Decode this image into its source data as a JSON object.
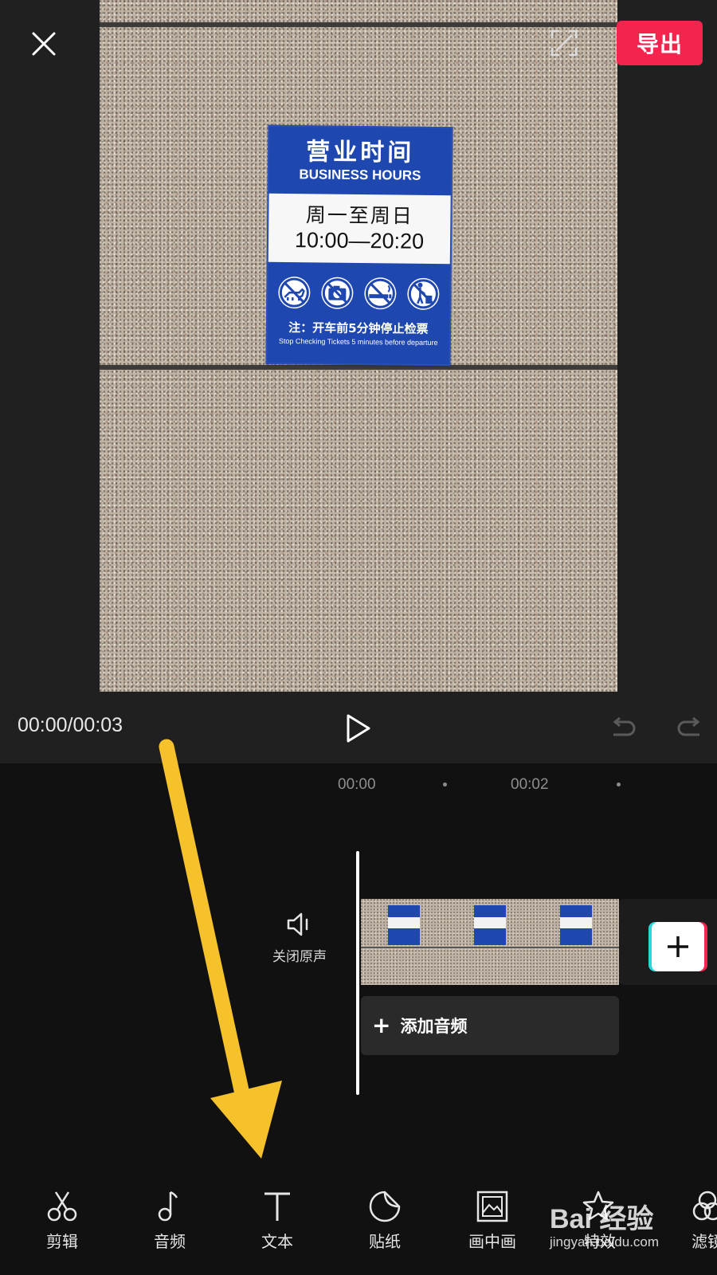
{
  "header": {
    "export_label": "导出"
  },
  "preview": {
    "sign": {
      "title_cn": "营业时间",
      "title_en": "BUSINESS HOURS",
      "days": "周一至周日",
      "hours": "10:00—20:20",
      "note_cn": "注：开车前5分钟停止检票",
      "note_en": "Stop Checking Tickets 5 minutes before departure"
    }
  },
  "playback": {
    "time": "00:00/00:03"
  },
  "timeline": {
    "ruler": [
      "00:00",
      "00:02"
    ],
    "mute_label": "关闭原声",
    "add_audio_label": "添加音频",
    "add_audio_plus": "+"
  },
  "toolbar": {
    "items": [
      {
        "label": "剪辑",
        "icon": "scissors-icon"
      },
      {
        "label": "音频",
        "icon": "music-note-icon"
      },
      {
        "label": "文本",
        "icon": "text-icon"
      },
      {
        "label": "贴纸",
        "icon": "sticker-icon"
      },
      {
        "label": "画中画",
        "icon": "picture-in-picture-icon"
      },
      {
        "label": "特效",
        "icon": "effects-star-icon"
      },
      {
        "label": "滤镜",
        "icon": "filter-icon"
      }
    ]
  },
  "watermark": {
    "brand": "Bai 经验",
    "url": "jingyan.baidu.com"
  },
  "colors": {
    "accent": "#f5244f",
    "annotation_arrow": "#f6c22c",
    "background": "#111111",
    "preview_background": "#202020"
  }
}
